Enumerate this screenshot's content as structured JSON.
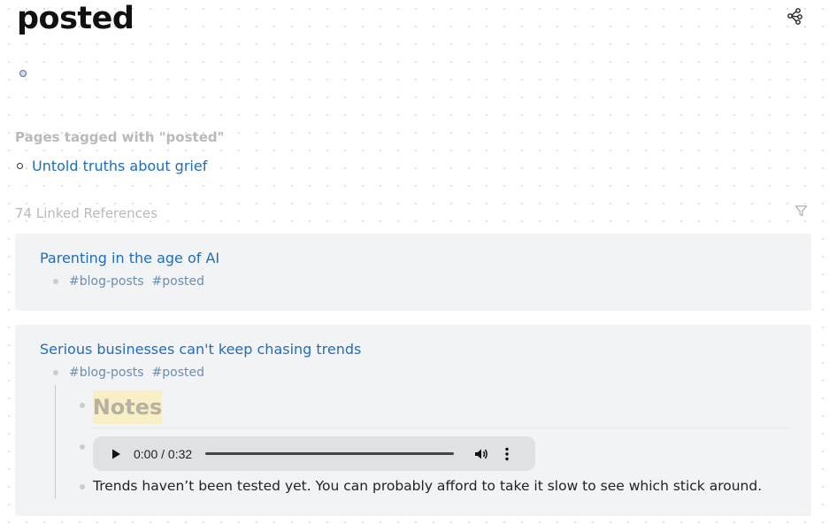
{
  "page": {
    "title": "posted"
  },
  "tagged": {
    "heading": "Pages tagged with \"posted\"",
    "items": [
      {
        "label": "Untold truths about grief"
      }
    ]
  },
  "references": {
    "heading": "74 Linked References",
    "cards": [
      {
        "page_title": "Parenting in the age of AI",
        "tags": [
          "#blog-posts",
          "#posted"
        ]
      },
      {
        "page_title": "Serious businesses can't keep chasing trends",
        "tags": [
          "#blog-posts",
          "#posted"
        ],
        "children": {
          "notes_heading": "Notes",
          "audio": {
            "time": "0:00 / 0:32",
            "progress": 0
          },
          "text": "Trends haven’t been tested yet. You can probably afford to take it slow to see which stick around."
        }
      }
    ]
  },
  "colors": {
    "link": "#1f6dbf",
    "tag": "#6c8eaf",
    "card_bg": "#f2f3f5",
    "highlight": "#f8efc7"
  },
  "icons": {
    "graph": "graph-view-icon",
    "filter": "filter-icon",
    "play": "play-icon",
    "volume": "volume-icon",
    "menu": "more-vertical-icon"
  }
}
